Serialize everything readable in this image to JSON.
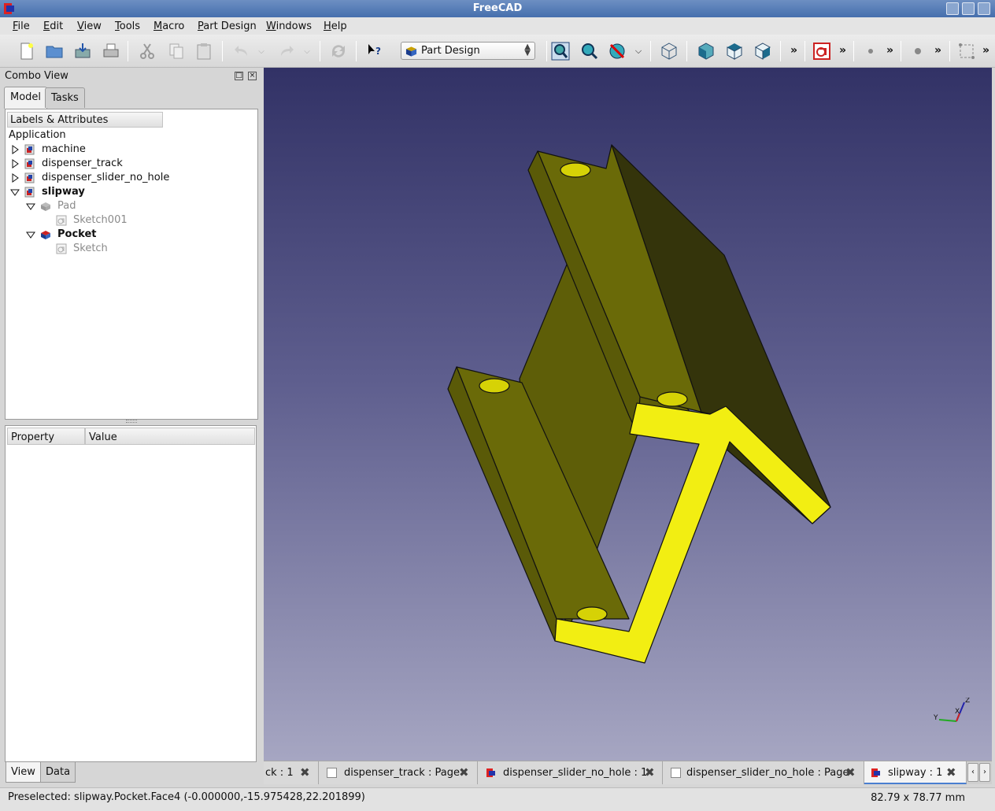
{
  "window": {
    "title": "FreeCAD"
  },
  "menu": [
    "File",
    "Edit",
    "View",
    "Tools",
    "Macro",
    "Part Design",
    "Windows",
    "Help"
  ],
  "toolbar": {
    "workbench": "Part Design",
    "more": "»"
  },
  "combo_view": {
    "title": "Combo View",
    "tabs": [
      "Model",
      "Tasks"
    ],
    "tree_header": "Labels & Attributes",
    "root": "Application",
    "documents": [
      {
        "label": "machine"
      },
      {
        "label": "dispenser_track"
      },
      {
        "label": "dispenser_slider_no_hole"
      },
      {
        "label": "slipway"
      }
    ],
    "features": [
      {
        "label": "Pad",
        "child": "Sketch001"
      },
      {
        "label": "Pocket",
        "child": "Sketch"
      }
    ],
    "property_headers": [
      "Property",
      "Value"
    ],
    "bottom_tabs": [
      "View",
      "Data"
    ]
  },
  "doc_tabs": [
    {
      "label": "ck : 1"
    },
    {
      "label": "dispenser_track : Page"
    },
    {
      "label": "dispenser_slider_no_hole : 1"
    },
    {
      "label": "dispenser_slider_no_hole : Page"
    },
    {
      "label": "slipway : 1"
    }
  ],
  "axis_labels": {
    "z": "Z",
    "y": "Y",
    "x": "X"
  },
  "colors": {
    "model_body": "#6a6a08",
    "model_shadow": "#34340b",
    "model_face_selected": "#f2ee12",
    "viewport_top": "#323266",
    "viewport_bottom": "#a6a6c2"
  },
  "status": {
    "preselected": "Preselected: slipway.Pocket.Face4 (-0.000000,-15.975428,22.201899)",
    "dimensions": "82.79 x 78.77 mm"
  }
}
